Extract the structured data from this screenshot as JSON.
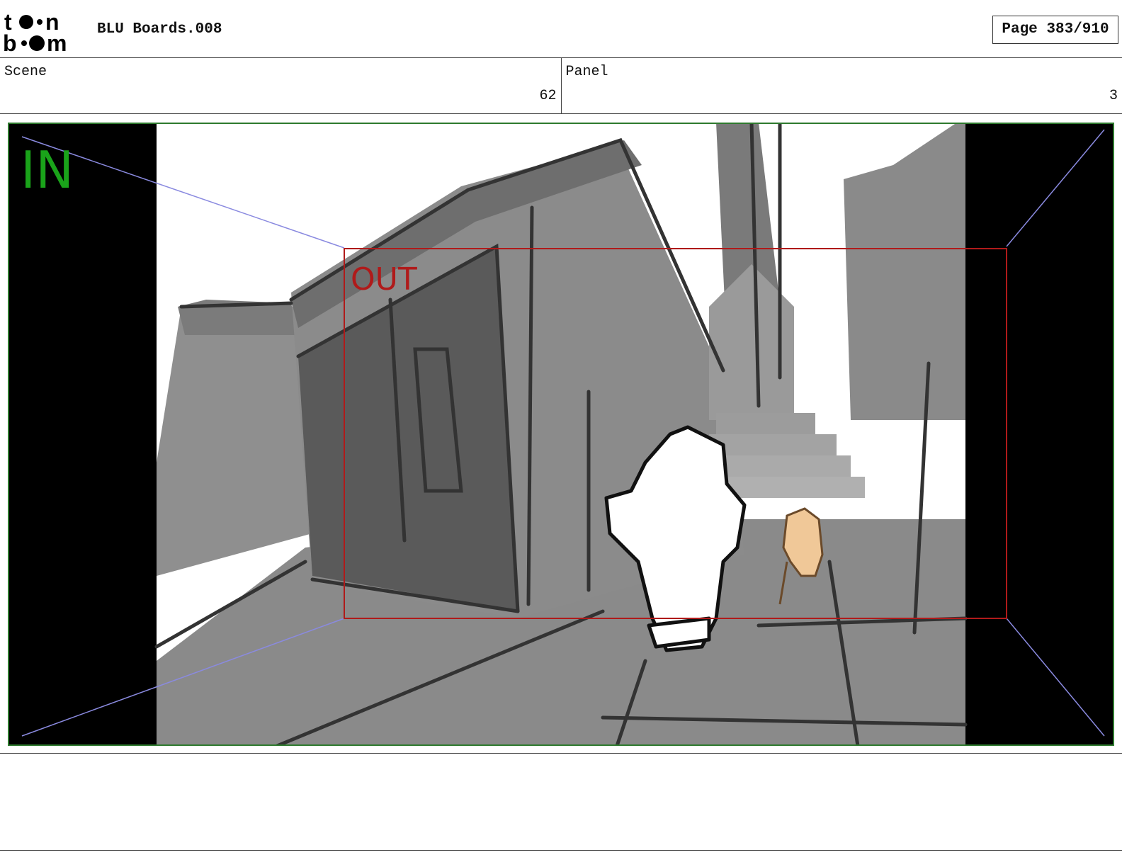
{
  "header": {
    "logo_text": "toon boom",
    "project_title": "BLU Boards.008",
    "page_indicator": "Page 383/910"
  },
  "info": {
    "scene_label": "Scene",
    "scene_number": "62",
    "panel_label": "Panel",
    "panel_number": "3"
  },
  "frame": {
    "in_label": "IN",
    "out_label": "OUT",
    "in_color": "#1aa31a",
    "out_color": "#b01a1a"
  },
  "notes": {
    "text": ""
  }
}
